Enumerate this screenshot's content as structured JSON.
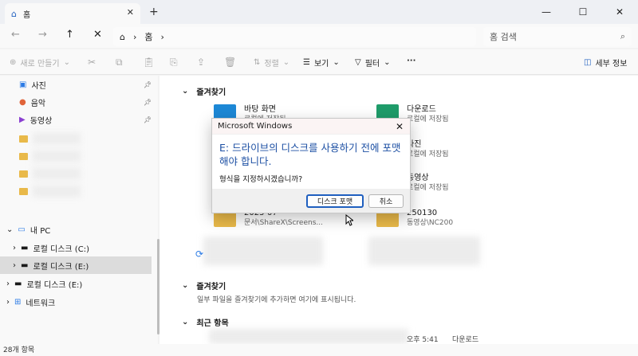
{
  "tab": {
    "title": "홈",
    "close": "✕",
    "add": "+"
  },
  "window": {
    "minimize": "—",
    "maximize": "☐",
    "close": "✕"
  },
  "address": {
    "path_root": "홈",
    "separator": "›"
  },
  "search": {
    "placeholder": "홈 검색"
  },
  "commands": {
    "new": "새로 만들기",
    "sort": "정렬",
    "view": "보기",
    "filter": "필터",
    "more": "···",
    "details": "세부 정보"
  },
  "sidebar": {
    "pinned": [
      {
        "label": "사진"
      },
      {
        "label": "음악"
      },
      {
        "label": "동영상"
      }
    ],
    "this_pc": "내 PC",
    "drives": [
      {
        "label": "로컬 디스크 (C:)"
      },
      {
        "label": "로컬 디스크 (E:)"
      },
      {
        "label": "로컬 디스크 (E:)"
      }
    ],
    "network": "네트워크"
  },
  "main": {
    "quick_access_title": "즐겨찾기",
    "quick_items": [
      {
        "name": "바탕 화면",
        "sub": "로컬에 저장됨"
      },
      {
        "name": "다운로드",
        "sub": "로컬에 저장됨"
      },
      {
        "name": "사진",
        "sub": "로컬에 저장됨"
      },
      {
        "name": "동영상",
        "sub": "로컬에 저장됨"
      },
      {
        "name": "2025-07",
        "sub": "문서\\ShareX\\Screens..."
      },
      {
        "name": "250130",
        "sub": "동영상\\NC200"
      }
    ],
    "favorites_title": "즐겨찾기",
    "favorites_empty": "일부 파일을 즐겨찾기에 추가하면 여기에 표시됩니다.",
    "recent_title": "최근 항목",
    "recent_row": {
      "time": "오후 5:41",
      "location": "다운로드"
    }
  },
  "status": {
    "count": "28개 항목"
  },
  "dialog": {
    "title": "Microsoft Windows",
    "message": "E: 드라이브의 디스크를 사용하기 전에 포맷해야 합니다.",
    "question": "형식을 지정하시겠습니까?",
    "format_button": "디스크 포맷",
    "cancel_button": "취소"
  },
  "colors": {
    "accent": "#1f5fbf",
    "folder": "#e9b949",
    "dialog_text": "#1c4fa3"
  }
}
